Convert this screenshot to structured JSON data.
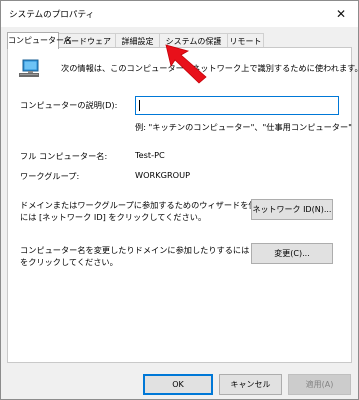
{
  "window": {
    "title": "システムのプロパティ",
    "close_glyph": "✕"
  },
  "tabs": [
    {
      "label": "コンピューター名"
    },
    {
      "label": "ハードウェア"
    },
    {
      "label": "詳細設定"
    },
    {
      "label": "システムの保護"
    },
    {
      "label": "リモート"
    }
  ],
  "panel": {
    "intro_text": "次の情報は、このコンピューターをネットワーク上で識別するために使われます。",
    "description_label": "コンピューターの説明(D):",
    "description_value": "",
    "example_text": "例: \"キッチンのコンピューター\"、\"仕事用コンピューター\"",
    "full_name_label": "フル コンピューター名:",
    "full_name_value": "Test-PC",
    "workgroup_label": "ワークグループ:",
    "workgroup_value": "WORKGROUP",
    "network_text_line1": "ドメインまたはワークグループに参加するためのウィザードを使用する",
    "network_text_line2": "には [ネットワーク ID] をクリックしてください。",
    "network_button": "ネットワーク ID(N)...",
    "change_text_line1": "コンピューター名を変更したりドメインに参加したりするには [変更]",
    "change_text_line2": "をクリックしてください。",
    "change_button": "変更(C)..."
  },
  "footer": {
    "ok": "OK",
    "cancel": "キャンセル",
    "apply": "適用(A)"
  },
  "colors": {
    "accent": "#0078d7",
    "arrow": "#e8101a"
  }
}
